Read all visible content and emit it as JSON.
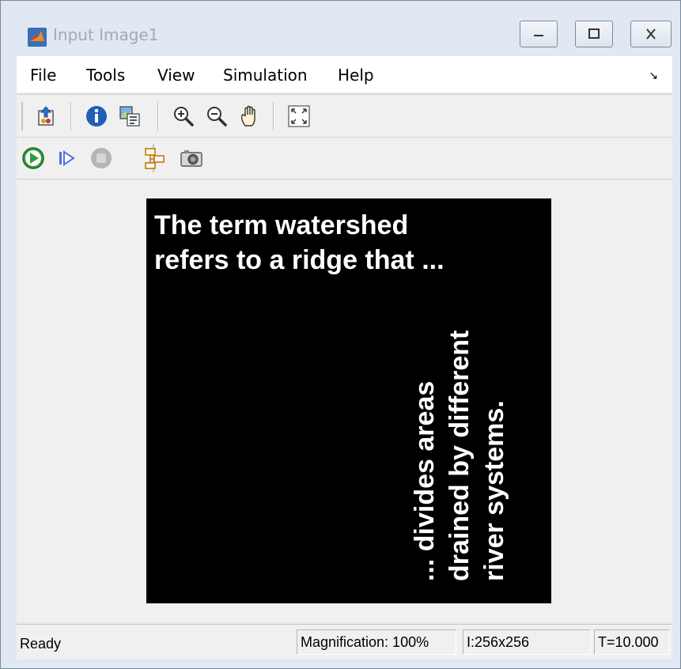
{
  "window": {
    "title": "Input Image1"
  },
  "menu": {
    "items": [
      {
        "id": "file",
        "label": "File"
      },
      {
        "id": "tools",
        "label": "Tools"
      },
      {
        "id": "view",
        "label": "View"
      },
      {
        "id": "simulation",
        "label": "Simulation"
      },
      {
        "id": "help",
        "label": "Help"
      }
    ],
    "overflow_arrow": "↘"
  },
  "toolbar": {
    "row1": [
      "parent-model-icon",
      "info-icon",
      "copy-image-icon",
      "zoom-in-icon",
      "zoom-out-icon",
      "pan-hand-icon",
      "fit-to-view-icon"
    ],
    "row2": [
      "run-icon",
      "step-forward-icon",
      "stop-icon",
      "highlight-block-icon",
      "snapshot-camera-icon"
    ]
  },
  "image_content": {
    "top_text": "The term watershed\nrefers to a ridge that ...",
    "rotated_text": "... divides areas\ndrained by different\nriver systems."
  },
  "status": {
    "ready": "Ready",
    "magnification": "Magnification: 100%",
    "size": "I:256x256",
    "time": "T=10.000"
  },
  "colors": {
    "window_frame": "#dfe8f3",
    "run_green": "#2e9d3a",
    "image_background": "#000000",
    "image_text": "#ffffff"
  }
}
